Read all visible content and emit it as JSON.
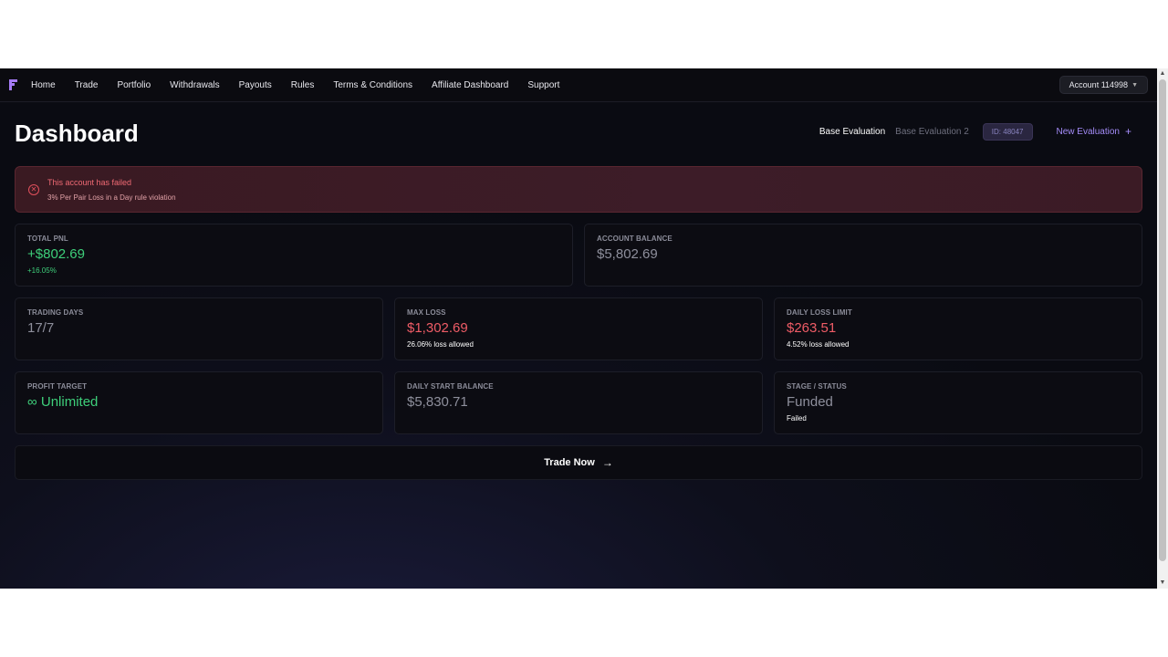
{
  "nav": {
    "items": [
      "Home",
      "Trade",
      "Portfolio",
      "Withdrawals",
      "Payouts",
      "Rules",
      "Terms & Conditions",
      "Affiliate Dashboard",
      "Support"
    ],
    "account_label": "Account 114998",
    "logo_icon": "logo-f-icon"
  },
  "page": {
    "title": "Dashboard"
  },
  "evaluations": {
    "tabs": [
      "Base Evaluation",
      "Base Evaluation 2"
    ],
    "active_index": 0,
    "id_badge": "ID: 48047",
    "new_label": "New Evaluation"
  },
  "alert": {
    "title": "This account has failed",
    "description": "3% Per Pair Loss in a Day rule violation",
    "icon": "x-circle-icon"
  },
  "stats": {
    "total_pnl": {
      "label": "TOTAL PNL",
      "value": "+$802.69",
      "sub": "+16.05%"
    },
    "account_balance": {
      "label": "ACCOUNT BALANCE",
      "value": "$5,802.69"
    },
    "trading_days": {
      "label": "TRADING DAYS",
      "value": "17/7"
    },
    "max_loss": {
      "label": "MAX LOSS",
      "value": "$1,302.69",
      "sub": "26.06% loss allowed"
    },
    "daily_loss_limit": {
      "label": "DAILY LOSS LIMIT",
      "value": "$263.51",
      "sub": "4.52% loss allowed"
    },
    "profit_target": {
      "label": "PROFIT TARGET",
      "value": "∞ Unlimited"
    },
    "daily_start_balance": {
      "label": "DAILY START BALANCE",
      "value": "$5,830.71"
    },
    "stage_status": {
      "label": "STAGE / STATUS",
      "value": "Funded",
      "sub": "Failed"
    }
  },
  "trade_now": {
    "label": "Trade Now",
    "icon": "arrow-right-icon"
  },
  "colors": {
    "accent": "#a48cf8",
    "positive": "#3ecf7a",
    "negative": "#ef5c66",
    "alert_bg": "#3a1a22"
  }
}
